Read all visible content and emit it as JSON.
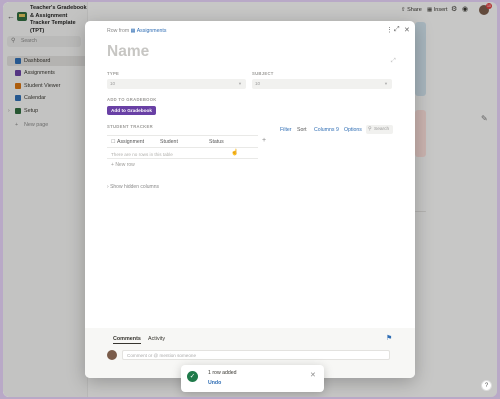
{
  "sidebar": {
    "workspace_title": "Teacher's Gradebook & Assignment Tracker Template (TPT)",
    "search_label": "Search",
    "items": [
      {
        "label": "Dashboard",
        "color": "#2e6db4"
      },
      {
        "label": "Assignments",
        "color": "#6940a5"
      },
      {
        "label": "Student Viewer",
        "color": "#d9730d"
      },
      {
        "label": "Calendar",
        "color": "#2e6db4"
      },
      {
        "label": "Setup",
        "color": "#2f6b3d"
      }
    ],
    "new_page_label": "New page"
  },
  "topbar": {
    "share_label": "Share",
    "insert_label": "Insert",
    "notification_count": "10"
  },
  "modal": {
    "row_from_prefix": "Row from",
    "row_from_link": "Assignments",
    "title_placeholder": "Name",
    "type_label": "TYPE",
    "type_value": "10",
    "subject_label": "SUBJECT",
    "subject_value": "10",
    "add_to_gradebook_label": "ADD TO GRADEBOOK",
    "add_to_gradebook_button": "Add to Gradebook",
    "student_tracker_label": "STUDENT TRACKER",
    "tools": {
      "filter": "Filter",
      "sort": "Sort",
      "columns": "Columns",
      "columns_count": "9",
      "options": "Options",
      "search": "Search"
    },
    "table_headers": [
      "Assignment",
      "Student",
      "Status"
    ],
    "empty_message": "There are no rows in this table",
    "new_row_label": "New row",
    "hidden_columns_label": "Show hidden columns",
    "comments_tab": "Comments",
    "activity_tab": "Activity",
    "comment_placeholder": "Comment or @ mention someone"
  },
  "toast": {
    "message": "1 row added",
    "undo_label": "Undo"
  },
  "help_label": "?"
}
